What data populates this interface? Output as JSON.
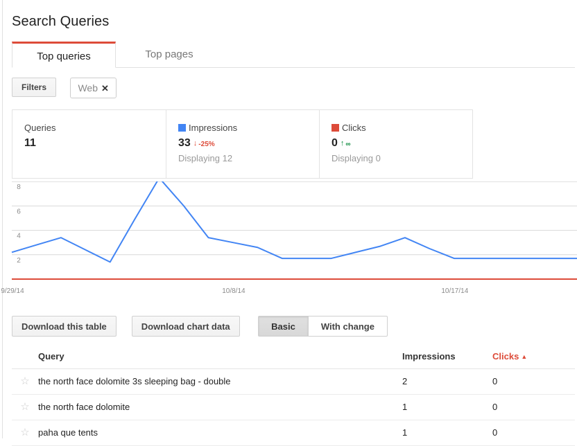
{
  "header": {
    "title": "Search Queries"
  },
  "tabs": [
    {
      "label": "Top queries",
      "active": true
    },
    {
      "label": "Top pages",
      "active": false
    }
  ],
  "filters": {
    "button_label": "Filters",
    "chip_label": "Web",
    "chip_close": "✕"
  },
  "stats": {
    "queries": {
      "label": "Queries",
      "value": "11"
    },
    "impressions": {
      "label": "Impressions",
      "swatch_color": "#4285f4",
      "value": "33",
      "delta_arrow": "↓",
      "delta_text": "-25%",
      "delta_direction": "down",
      "sub": "Displaying 12"
    },
    "clicks": {
      "label": "Clicks",
      "swatch_color": "#dd4b39",
      "value": "0",
      "delta_arrow": "↑",
      "delta_text": "∞",
      "delta_direction": "up",
      "sub": "Displaying 0"
    }
  },
  "chart_data": {
    "type": "line",
    "title": "",
    "xlabel": "",
    "ylabel": "",
    "grid": true,
    "legend_position": "above-chart",
    "ylim": [
      0,
      9.2
    ],
    "yticks": [
      2,
      4,
      6,
      8
    ],
    "ytick_labels": [
      "2",
      "4",
      "6",
      "8"
    ],
    "x_tick_labels": [
      "9/29/14",
      "10/8/14",
      "10/17/14"
    ],
    "x_tick_indices": [
      0,
      9,
      18
    ],
    "x": [
      "9/29/14",
      "9/30/14",
      "10/1/14",
      "10/2/14",
      "10/3/14",
      "10/4/14",
      "10/5/14",
      "10/6/14",
      "10/7/14",
      "10/8/14",
      "10/9/14",
      "10/10/14",
      "10/11/14",
      "10/12/14",
      "10/13/14",
      "10/14/14",
      "10/15/14",
      "10/16/14",
      "10/17/14",
      "10/18/14",
      "10/19/14",
      "10/20/14",
      "10/21/14",
      "10/22/14"
    ],
    "series": [
      {
        "name": "Impressions",
        "color": "#4285f4",
        "values": [
          2.2,
          2.8,
          3.4,
          2.4,
          1.4,
          4.9,
          8.3,
          6.0,
          3.4,
          3.0,
          2.6,
          1.7,
          1.7,
          1.7,
          2.2,
          2.7,
          3.4,
          2.5,
          1.7,
          1.7,
          1.7,
          1.7,
          1.7,
          1.7
        ]
      },
      {
        "name": "Clicks",
        "color": "#dd4b39",
        "values": [
          0,
          0,
          0,
          0,
          0,
          0,
          0,
          0,
          0,
          0,
          0,
          0,
          0,
          0,
          0,
          0,
          0,
          0,
          0,
          0,
          0,
          0,
          0,
          0
        ]
      }
    ]
  },
  "actions": {
    "download_table": "Download this table",
    "download_chart": "Download chart data",
    "basic": "Basic",
    "with_change": "With change",
    "selected_view": "Basic"
  },
  "table": {
    "columns": [
      "Query",
      "Impressions",
      "Clicks"
    ],
    "sort_column": "Clicks",
    "sort_caret": "▲",
    "star_glyph": "☆",
    "rows": [
      {
        "query": "the north face dolomite 3s sleeping bag - double",
        "impressions": "2",
        "clicks": "0"
      },
      {
        "query": "the north face dolomite",
        "impressions": "1",
        "clicks": "0"
      },
      {
        "query": "paha que tents",
        "impressions": "1",
        "clicks": "0"
      }
    ]
  }
}
